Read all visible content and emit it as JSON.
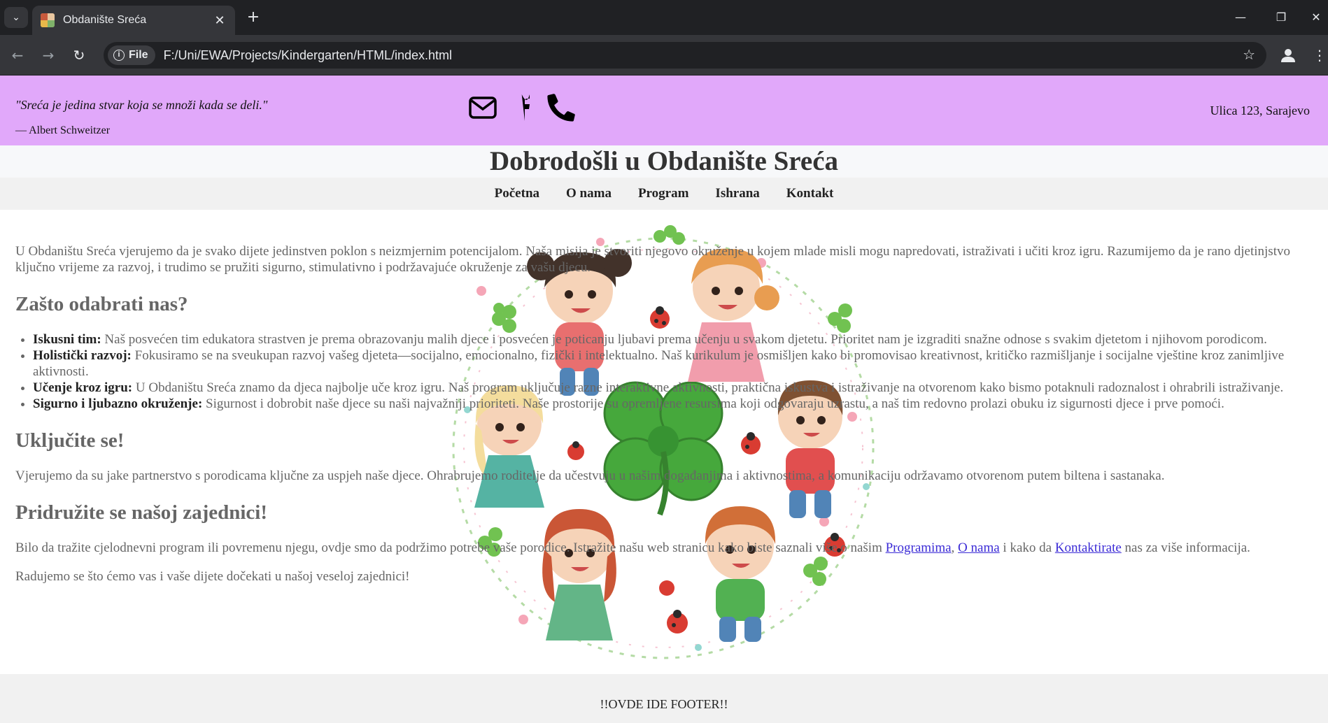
{
  "browser": {
    "tab_title": "Obdanište Sreća",
    "tab_menu_icon": "chevron-down-icon",
    "new_tab_icon": "plus-icon",
    "close_tab_symbol": "✕",
    "new_tab_symbol": "+",
    "chip_label": "File",
    "url": "F:/Uni/EWA/Projects/Kindergarten/HTML/index.html"
  },
  "topbar": {
    "quote": "\"Sreća je jedina stvar koja se množi kada se deli.\"",
    "author": "— Albert Schweitzer",
    "address": "Ulica 123, Sarajevo",
    "background": "#e1a8fa",
    "icons": [
      "envelope-icon",
      "facebook-icon",
      "phone-icon"
    ]
  },
  "header": {
    "title": "Dobrodošli u Obdanište Sreća"
  },
  "nav": {
    "items": [
      "Početna",
      "O nama",
      "Program",
      "Ishrana",
      "Kontakt"
    ]
  },
  "main": {
    "intro": "U Obdaništu Sreća vjerujemo da je svako dijete jedinstven poklon s neizmjernim potencijalom. Naša misija je stvoriti njegovo okruženje u kojem mlade misli mogu napredovati, istraživati i učiti kroz igru. Razumijemo da je rano djetinjstvo ključno vrijeme za razvoj, i trudimo se pružiti sigurno, stimulativno i podržavajuće okruženje za vašu djecu.",
    "why_heading": "Zašto odabrati nas?",
    "features": [
      {
        "title": "Iskusni tim:",
        "text": " Naš posvećen tim edukatora strastven je prema obrazovanju malih djece i posvećen je poticanju ljubavi prema učenju u svakom djetetu. Prioritet nam je izgraditi snažne odnose s svakim djetetom i njihovom porodicom."
      },
      {
        "title": "Holistički razvoj:",
        "text": " Fokusiramo se na sveukupan razvoj vašeg djeteta—socijalno, emocionalno, fizički i intelektualno. Naš kurikulum je osmišljen kako bi promovisao kreativnost, kritičko razmišljanje i socijalne vještine kroz zanimljive aktivnosti."
      },
      {
        "title": "Učenje kroz igru:",
        "text": " U Obdaništu Sreća znamo da djeca najbolje uče kroz igru. Naš program uključuje razne interaktivne aktivnosti, praktična iskustva i istraživanje na otvorenom kako bismo potaknuli radoznalost i ohrabrili istraživanje."
      },
      {
        "title": "Sigurno i ljubazno okruženje:",
        "text": " Sigurnost i dobrobit naše djece su naši najvažniji prioriteti. Naše prostorije su opremljene resursima koji odgovaraju uzrastu, a naš tim redovno prolazi obuku iz sigurnosti djece i prve pomoći."
      }
    ],
    "involve_heading": "Uključite se!",
    "involve_text": "Vjerujemo da su jake partnerstvo s porodicama ključne za uspjeh naše djece. Ohrabrujemo roditelje da učestvuju u našim događanjima i aktivnostima, a komunikaciju održavamo otvorenom putem biltena i sastanaka.",
    "join_heading": "Pridružite se našoj zajednici!",
    "join_text_before": "Bilo da tražite cjelodnevni program ili povremenu njegu, ovdje smo da podržimo potrebe vaše porodice. Istražite našu web stranicu kako biste saznali više o našim ",
    "link_programs": "Programima",
    "join_comma": ", ",
    "link_about": "O nama",
    "join_middle": " i kako da ",
    "link_contact": "Kontaktirate",
    "join_after": " nas za više informacija.",
    "closing": "Radujemo se što ćemo vas i vaše dijete dočekati u našoj veseloj zajednici!",
    "hero_image": "children-clover-illustration"
  },
  "footer": {
    "text": "!!OVDE IDE FOOTER!!"
  }
}
